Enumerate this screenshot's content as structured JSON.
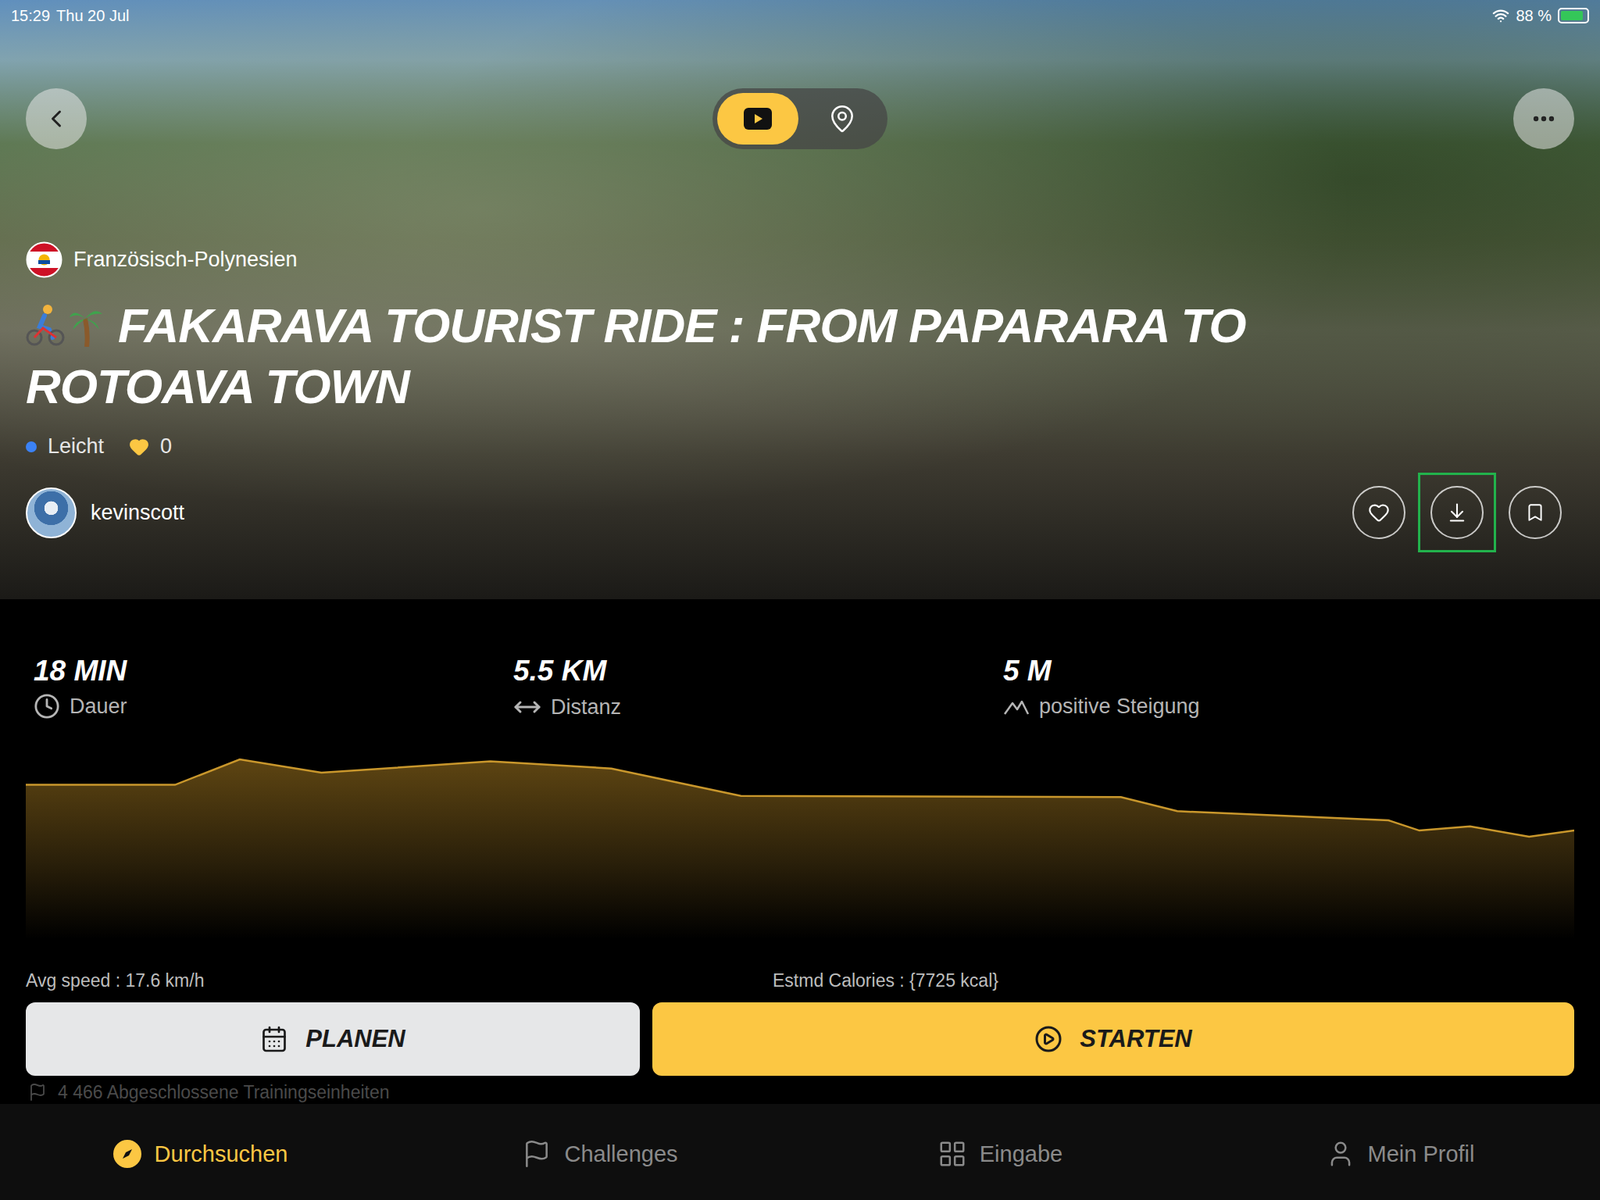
{
  "status_bar": {
    "time": "15:29",
    "date": "Thu 20 Jul",
    "battery": "88 %",
    "battery_level": 0.88,
    "charging": true
  },
  "view_modes": [
    {
      "kind": "video",
      "selected": true
    },
    {
      "kind": "map",
      "selected": false
    }
  ],
  "country": "Französisch-Polynesien",
  "title": "FAKARAVA TOURIST RIDE : FROM PAPARARA TO ROTOAVA TOWN",
  "difficulty": {
    "label": "Leicht",
    "color": "#3b82f6"
  },
  "likes": "0",
  "author": "kevinscott",
  "actions": [
    {
      "kind": "like",
      "highlighted": false
    },
    {
      "kind": "download",
      "highlighted": true
    },
    {
      "kind": "bookmark",
      "highlighted": false
    }
  ],
  "stats": [
    {
      "kind": "duration",
      "value": "18 MIN",
      "label": "Dauer"
    },
    {
      "kind": "distance",
      "value": "5.5 KM",
      "label": "Distanz"
    },
    {
      "kind": "elevation",
      "value": "5 M",
      "label": "positive Steigung"
    }
  ],
  "elevation_chart": {
    "distance_km": [
      0,
      0.53,
      0.76,
      1.05,
      1.65,
      2.08,
      2.54,
      3.89,
      4.09,
      4.84,
      4.95,
      5.13,
      5.34,
      5.5
    ],
    "elevation_m": [
      4.33,
      4.33,
      6.0,
      5.13,
      5.87,
      5.4,
      3.6,
      3.53,
      2.6,
      2.0,
      1.33,
      1.6,
      0.93,
      1.33
    ]
  },
  "avg_speed": "Avg speed : 17.6 km/h",
  "calories": "Estmd Calories : {7725 kcal}",
  "buttons": [
    {
      "kind": "plan",
      "label": "PLANEN"
    },
    {
      "kind": "start",
      "label": "STARTEN"
    }
  ],
  "completed": "4 466 Abgeschlossene Trainingseinheiten",
  "nav": [
    {
      "kind": "browse",
      "label": "Durchsuchen",
      "selected": true
    },
    {
      "kind": "challenges",
      "label": "Challenges",
      "selected": false
    },
    {
      "kind": "input",
      "label": "Eingabe",
      "selected": false
    },
    {
      "kind": "profile",
      "label": "Mein Profil",
      "selected": false
    }
  ]
}
